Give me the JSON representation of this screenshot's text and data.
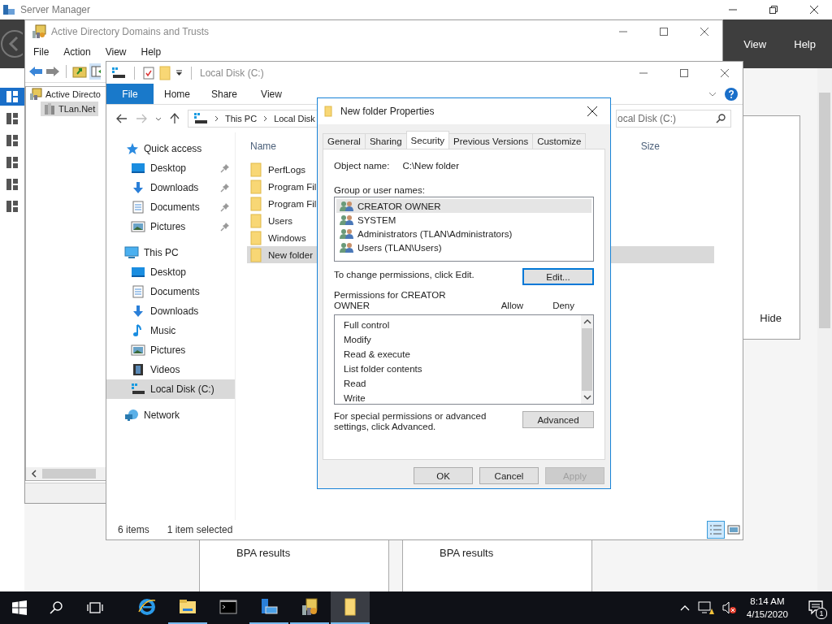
{
  "server_manager": {
    "title": "Server Manager",
    "menu": [
      "View",
      "Help"
    ],
    "sidebar": [
      {
        "selected": true
      },
      {
        "selected": false
      },
      {
        "selected": false
      },
      {
        "selected": false
      },
      {
        "selected": false
      },
      {
        "selected": false
      }
    ],
    "panel_button": "Hide",
    "tiles": [
      {
        "title": "BPA results"
      },
      {
        "title": "BPA results"
      }
    ]
  },
  "ad_window": {
    "title": "Active Directory Domains and Trusts",
    "menu": [
      "File",
      "Action",
      "View",
      "Help"
    ],
    "tree": [
      {
        "label": "Active Directo",
        "selected": false,
        "children": [
          {
            "label": "TLan.Net",
            "selected": true
          }
        ]
      }
    ]
  },
  "explorer": {
    "title": "Local Disk (C:)",
    "ribbon_tabs": [
      {
        "label": "File",
        "selected": true
      },
      {
        "label": "Home",
        "selected": false
      },
      {
        "label": "Share",
        "selected": false
      },
      {
        "label": "View",
        "selected": false
      }
    ],
    "breadcrumb": [
      "This PC",
      "Local Disk"
    ],
    "search": {
      "placeholder": "ocal Disk (C:)"
    },
    "nav": [
      {
        "label": "Quick access",
        "kind": "star",
        "selected": false,
        "children": [
          {
            "label": "Desktop",
            "kind": "desktop",
            "pinned": true,
            "selected": false
          },
          {
            "label": "Downloads",
            "kind": "download",
            "pinned": true,
            "selected": false
          },
          {
            "label": "Documents",
            "kind": "document",
            "pinned": true,
            "selected": false
          },
          {
            "label": "Pictures",
            "kind": "picture",
            "pinned": true,
            "selected": false
          }
        ]
      },
      {
        "label": "This PC",
        "kind": "pc",
        "selected": false,
        "children": [
          {
            "label": "Desktop",
            "kind": "desktop",
            "pinned": false,
            "selected": false
          },
          {
            "label": "Documents",
            "kind": "document",
            "pinned": false,
            "selected": false
          },
          {
            "label": "Downloads",
            "kind": "download",
            "pinned": false,
            "selected": false
          },
          {
            "label": "Music",
            "kind": "music",
            "pinned": false,
            "selected": false
          },
          {
            "label": "Pictures",
            "kind": "picture",
            "pinned": false,
            "selected": false
          },
          {
            "label": "Videos",
            "kind": "video",
            "pinned": false,
            "selected": false
          },
          {
            "label": "Local Disk (C:)",
            "kind": "drive",
            "pinned": false,
            "selected": true
          }
        ]
      },
      {
        "label": "Network",
        "kind": "network",
        "selected": false
      }
    ],
    "columns": [
      "Name",
      "Size"
    ],
    "files": [
      {
        "name": "PerfLogs",
        "selected": false
      },
      {
        "name": "Program Fil",
        "selected": false
      },
      {
        "name": "Program Fil",
        "selected": false
      },
      {
        "name": "Users",
        "selected": false
      },
      {
        "name": "Windows",
        "selected": false
      },
      {
        "name": "New folder",
        "selected": true
      }
    ],
    "status": {
      "count": "6 items",
      "selection": "1 item selected"
    },
    "views": [
      {
        "kind": "details",
        "selected": true
      },
      {
        "kind": "tiles",
        "selected": false
      }
    ]
  },
  "dialog": {
    "title": "New folder Properties",
    "tabs": [
      {
        "label": "General",
        "selected": false
      },
      {
        "label": "Sharing",
        "selected": false
      },
      {
        "label": "Security",
        "selected": true
      },
      {
        "label": "Previous Versions",
        "selected": false
      },
      {
        "label": "Customize",
        "selected": false
      }
    ],
    "object_label": "Object name:",
    "object_value": "C:\\New folder",
    "group_label": "Group or user names:",
    "users": [
      {
        "name": "CREATOR OWNER",
        "selected": true
      },
      {
        "name": "SYSTEM",
        "selected": false
      },
      {
        "name": "Administrators (TLAN\\Administrators)",
        "selected": false
      },
      {
        "name": "Users (TLAN\\Users)",
        "selected": false
      }
    ],
    "change_hint": "To change permissions, click Edit.",
    "edit_button": {
      "label": "Edit...",
      "focused": true
    },
    "permissions_label": "Permissions for CREATOR OWNER",
    "permission_columns": [
      "Allow",
      "Deny"
    ],
    "permissions": [
      "Full control",
      "Modify",
      "Read & execute",
      "List folder contents",
      "Read",
      "Write"
    ],
    "advanced_hint": "For special permissions or advanced settings, click Advanced.",
    "advanced_button": "Advanced",
    "buttons": [
      {
        "label": "OK",
        "disabled": false
      },
      {
        "label": "Cancel",
        "disabled": false
      },
      {
        "label": "Apply",
        "disabled": true
      }
    ]
  },
  "taskbar": {
    "apps": [
      {
        "kind": "ie",
        "running": false,
        "selected": false
      },
      {
        "kind": "explorer",
        "running": true,
        "selected": false
      },
      {
        "kind": "cmd",
        "running": false,
        "selected": false
      },
      {
        "kind": "server-manager",
        "running": true,
        "selected": false
      },
      {
        "kind": "ad-tool",
        "running": true,
        "selected": false
      },
      {
        "kind": "folder",
        "running": true,
        "selected": true
      }
    ],
    "time": "8:14 AM",
    "date": "4/15/2020",
    "notifications": "1"
  }
}
